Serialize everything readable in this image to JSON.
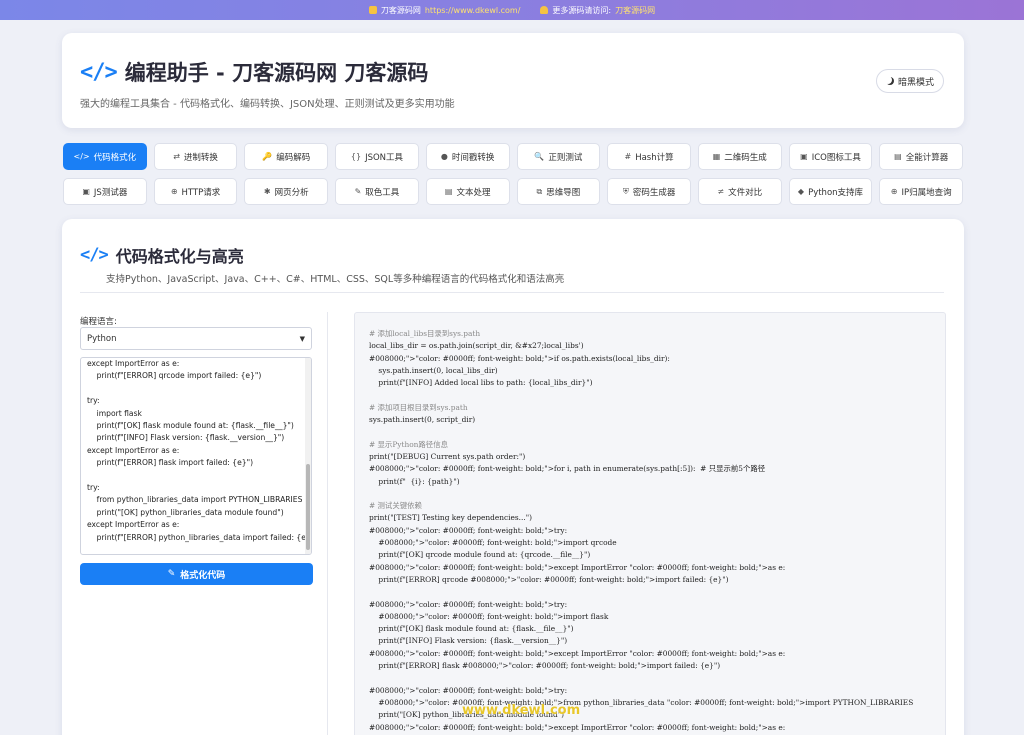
{
  "topbar": {
    "site_name": "刀客源码网",
    "site_url": "https://www.dkewl.com/",
    "more_text": "更多源码请访问:",
    "more_link": "刀客源码网"
  },
  "header": {
    "icon": "</>",
    "title": "编程助手 - 刀客源码网 刀客源码",
    "subtitle": "强大的编程工具集合 - 代码格式化、编码转换、JSON处理、正则测试及更多实用功能",
    "dark_mode_label": "暗黑模式"
  },
  "tools": {
    "row1": [
      {
        "icon": "</>",
        "label": "代码格式化",
        "active": true
      },
      {
        "icon": "⇄",
        "label": "进制转换"
      },
      {
        "icon": "🔑",
        "label": "编码解码"
      },
      {
        "icon": "{}",
        "label": "JSON工具"
      },
      {
        "icon": "●",
        "label": "时间戳转换"
      },
      {
        "icon": "🔍",
        "label": "正则测试"
      },
      {
        "icon": "#",
        "label": "Hash计算"
      },
      {
        "icon": "▦",
        "label": "二维码生成"
      },
      {
        "icon": "▣",
        "label": "ICO图标工具"
      },
      {
        "icon": "▤",
        "label": "全能计算器"
      }
    ],
    "row2": [
      {
        "icon": "▣",
        "label": "JS测试器"
      },
      {
        "icon": "⊕",
        "label": "HTTP请求"
      },
      {
        "icon": "✱",
        "label": "网页分析"
      },
      {
        "icon": "✎",
        "label": "取色工具"
      },
      {
        "icon": "▤",
        "label": "文本处理"
      },
      {
        "icon": "⧉",
        "label": "思维导图"
      },
      {
        "icon": "⛨",
        "label": "密码生成器"
      },
      {
        "icon": "≠",
        "label": "文件对比"
      },
      {
        "icon": "◆",
        "label": "Python支持库"
      },
      {
        "icon": "⊕",
        "label": "IP归属地查询"
      }
    ]
  },
  "section": {
    "icon": "</>",
    "title": "代码格式化与高亮",
    "description": "支持Python、JavaScript、Java、C++、C#、HTML、CSS、SQL等多种编程语言的代码格式化和语法高亮",
    "language_label": "编程语言:",
    "language_value": "Python",
    "format_button": "格式化代码"
  },
  "input_code": [
    "except ImportError as e:",
    "    print(f\"[ERROR] qrcode import failed: {e}\")",
    "",
    "try:",
    "    import flask",
    "    print(f\"[OK] flask module found at: {flask.__file__}\")",
    "    print(f\"[INFO] Flask version: {flask.__version__}\")",
    "except ImportError as e:",
    "    print(f\"[ERROR] flask import failed: {e}\")",
    "",
    "try:",
    "    from python_libraries_data import PYTHON_LIBRARIES",
    "    print(\"[OK] python_libraries_data module found\")",
    "except ImportError as e:",
    "    print(f\"[ERROR] python_libraries_data import failed: {e}\")"
  ],
  "output_code": [
    "# 添加local_libs目录到sys.path",
    "local_libs_dir = os.path.join(script_dir, &#x27;local_libs')",
    "#008000;\">\"color: #0000ff; font-weight: bold;\">if os.path.exists(local_libs_dir):",
    "    sys.path.insert(0, local_libs_dir)",
    "    print(f\"[INFO] Added local libs to path: {local_libs_dir}\")",
    "",
    "# 添加项目根目录到sys.path",
    "sys.path.insert(0, script_dir)",
    "",
    "# 显示Python路径信息",
    "print(\"[DEBUG] Current sys.path order:\")",
    "#008000;\">\"color: #0000ff; font-weight: bold;\">for i, path in enumerate(sys.path[:5]):  # 只显示前5个路径",
    "    print(f\"  {i}: {path}\")",
    "",
    "# 测试关键依赖",
    "print(\"[TEST] Testing key dependencies...\")",
    "#008000;\">\"color: #0000ff; font-weight: bold;\">try:",
    "    #008000;\">\"color: #0000ff; font-weight: bold;\">import qrcode",
    "    print(f\"[OK] qrcode module found at: {qrcode.__file__}\")",
    "#008000;\">\"color: #0000ff; font-weight: bold;\">except ImportError \"color: #0000ff; font-weight: bold;\">as e:",
    "    print(f\"[ERROR] qrcode #008000;\">\"color: #0000ff; font-weight: bold;\">import failed: {e}\")",
    "",
    "#008000;\">\"color: #0000ff; font-weight: bold;\">try:",
    "    #008000;\">\"color: #0000ff; font-weight: bold;\">import flask",
    "    print(f\"[OK] flask module found at: {flask.__file__}\")",
    "    print(f\"[INFO] Flask version: {flask.__version__}\")",
    "#008000;\">\"color: #0000ff; font-weight: bold;\">except ImportError \"color: #0000ff; font-weight: bold;\">as e:",
    "    print(f\"[ERROR] flask #008000;\">\"color: #0000ff; font-weight: bold;\">import failed: {e}\")",
    "",
    "#008000;\">\"color: #0000ff; font-weight: bold;\">try:",
    "    #008000;\">\"color: #0000ff; font-weight: bold;\">from python_libraries_data \"color: #0000ff; font-weight: bold;\">import PYTHON_LIBRARIES",
    "    print(\"[OK] python_libraries_data module found\")",
    "#008000;\">\"color: #0000ff; font-weight: bold;\">except ImportError \"color: #0000ff; font-weight: bold;\">as e:"
  ],
  "watermark": "www.dkewl.com"
}
